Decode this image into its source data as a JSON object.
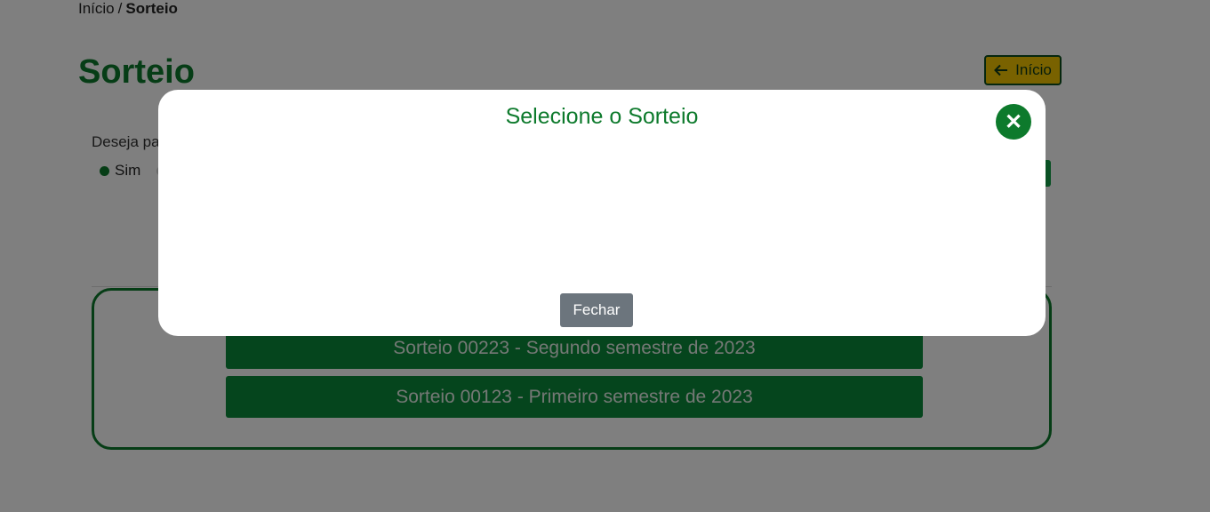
{
  "breadcrumb": {
    "home": "Início",
    "separator": "/",
    "current": "Sorteio"
  },
  "page": {
    "title": "Sorteio"
  },
  "header": {
    "home_button_label": "Início",
    "home_button_icon": "arrow-left-icon"
  },
  "form": {
    "question": "Deseja pa",
    "options": [
      {
        "label": "Sim",
        "selected": true
      }
    ]
  },
  "sorteios": [
    {
      "label": "Sorteio 00223 - Segundo semestre de 2023"
    },
    {
      "label": "Sorteio 00123 - Primeiro semestre de 2023"
    }
  ],
  "modal": {
    "title": "Selecione o Sorteio",
    "close_icon": "close-icon",
    "close_symbol": "✕",
    "dismiss_label": "Fechar"
  },
  "colors": {
    "primary_green": "#0d7a2c",
    "item_green": "#0b8a3a",
    "home_button_yellow": "#f2c500",
    "dismiss_gray": "#6c757d"
  }
}
